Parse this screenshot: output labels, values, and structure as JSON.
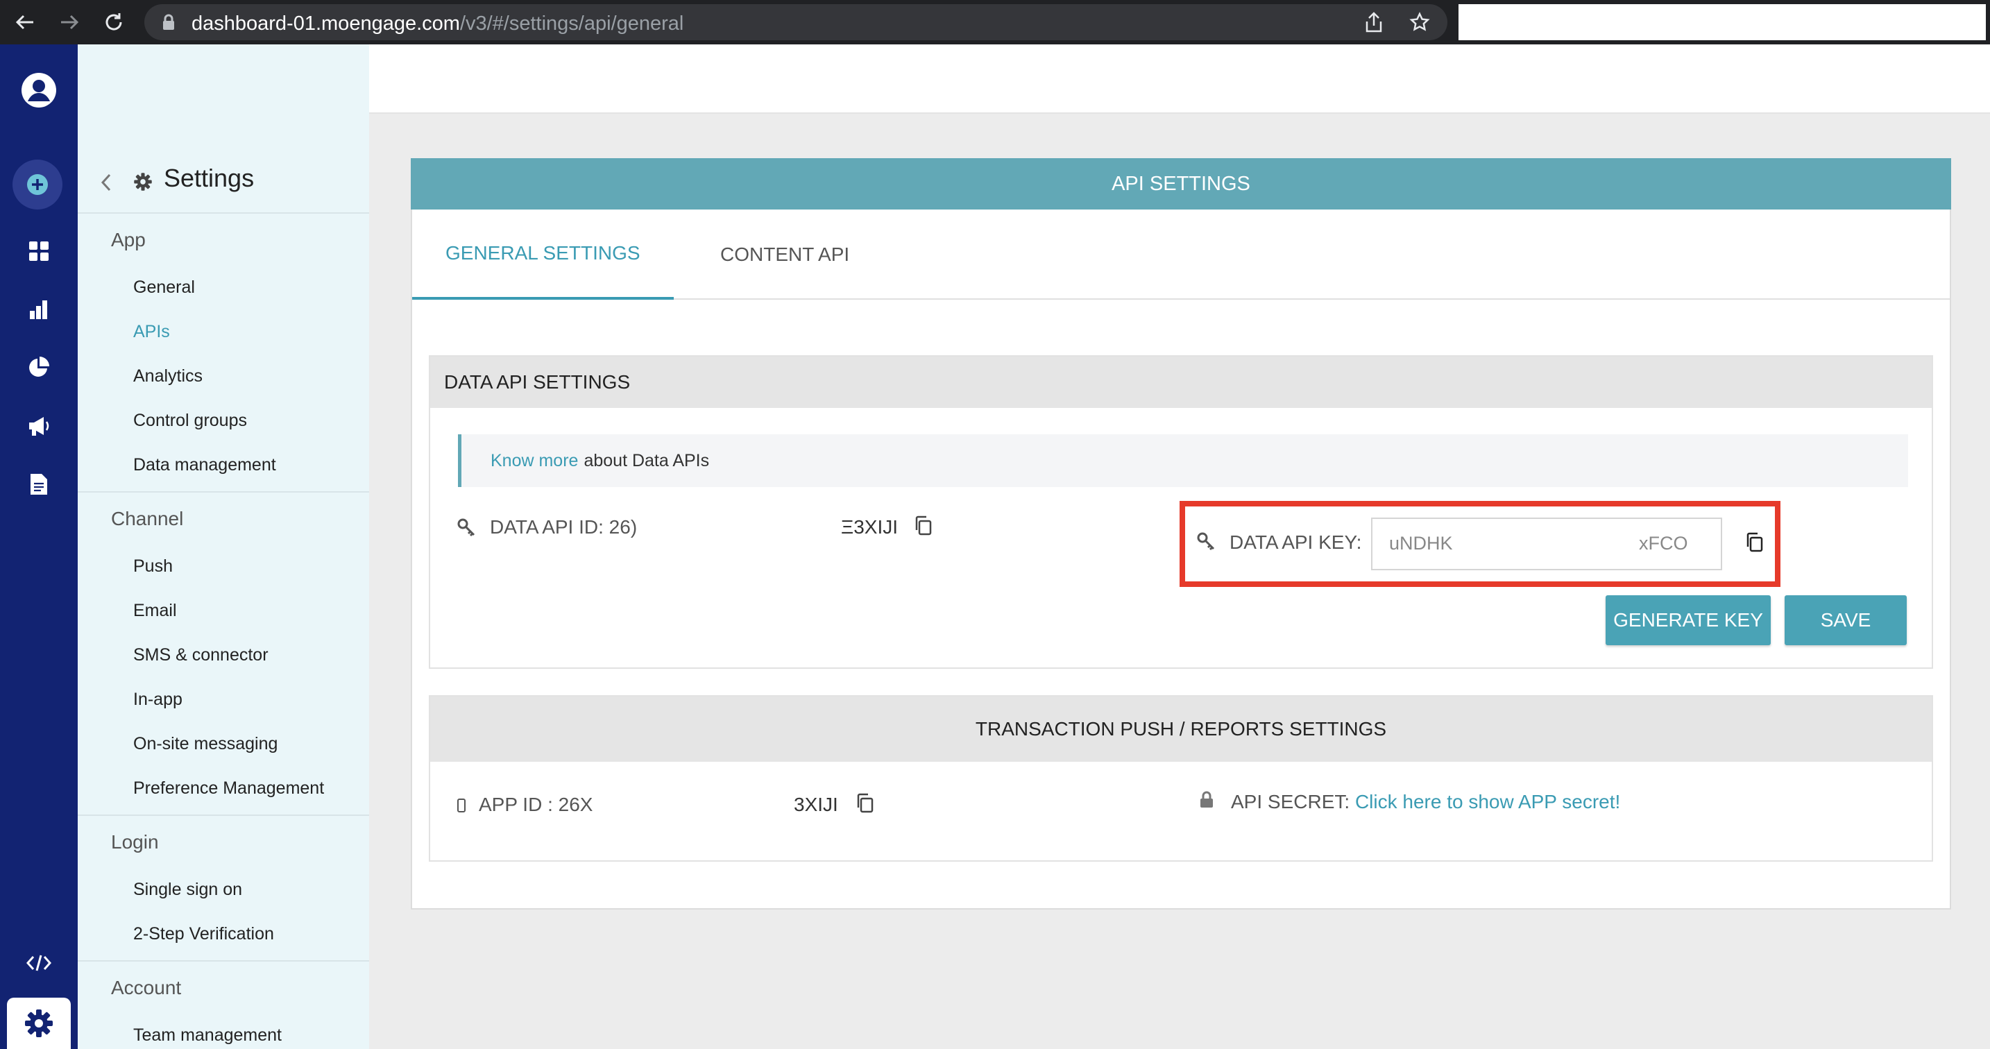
{
  "browser": {
    "host": "dashboard-01.moengage.com",
    "path": "/v3/#/settings/api/general"
  },
  "rail": {
    "icons": [
      "user-avatar-icon",
      "add-icon",
      "dashboard-icon",
      "bar-chart-icon",
      "pie-chart-icon",
      "megaphone-icon",
      "document-icon",
      "code-icon",
      "gear-icon"
    ]
  },
  "sidebar": {
    "title": "Settings",
    "sections": [
      {
        "title": "App",
        "items": [
          "General",
          "APIs",
          "Analytics",
          "Control groups",
          "Data management"
        ]
      },
      {
        "title": "Channel",
        "items": [
          "Push",
          "Email",
          "SMS & connector",
          "In-app",
          "On-site messaging",
          "Preference Management"
        ]
      },
      {
        "title": "Login",
        "items": [
          "Single sign on",
          "2-Step Verification"
        ]
      },
      {
        "title": "Account",
        "items": [
          "Team management"
        ]
      }
    ],
    "active_item": "APIs"
  },
  "main": {
    "header": "API SETTINGS",
    "tabs": [
      "GENERAL SETTINGS",
      "CONTENT API"
    ],
    "active_tab": "GENERAL SETTINGS",
    "data_api": {
      "title": "DATA API SETTINGS",
      "info_link": "Know more",
      "info_text": "about Data APIs",
      "api_id_label": "DATA API ID: 26)",
      "api_id_suffix": "Ξ3XIJI",
      "api_key_label": "DATA API KEY:",
      "api_key_start": "uNDHK",
      "api_key_end": "xFCO",
      "generate_label": "GENERATE KEY",
      "save_label": "SAVE"
    },
    "transaction": {
      "title": "TRANSACTION PUSH / REPORTS SETTINGS",
      "app_id_label": "APP ID : 26X",
      "app_id_suffix": "3XIJI",
      "secret_label": "API SECRET:",
      "secret_link": "Click here to show APP secret!"
    }
  },
  "colors": {
    "accent": "#3a9bb3",
    "header_teal": "#62a8b6",
    "rail": "#122372",
    "highlight_red": "#e63a2a"
  }
}
